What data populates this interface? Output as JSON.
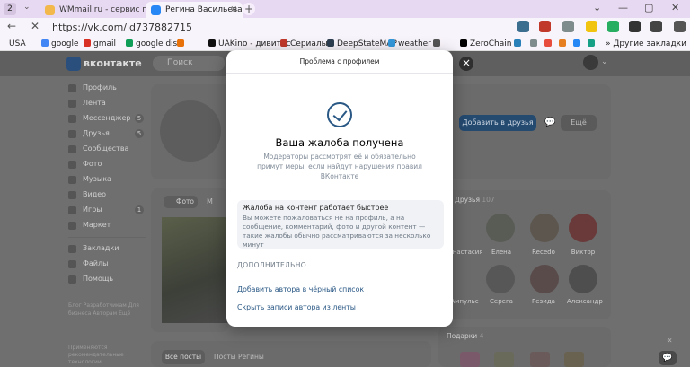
{
  "browser": {
    "tab_count": "2",
    "tabs": [
      {
        "title": "WMmail.ru - сервис почт"
      },
      {
        "title": "Регина Васильева"
      }
    ],
    "url": "https://vk.com/id737882715",
    "bookmarks": [
      "USA",
      "google",
      "gmail",
      "google disk",
      "",
      "UAKino - дивитис",
      "Сериалы",
      "DeepStateMAP",
      "weather",
      "",
      "ZeroChain",
      "",
      "",
      "",
      "",
      "",
      "",
      "Другие закладки"
    ]
  },
  "vk": {
    "brand": "вконтакте",
    "search_placeholder": "Поиск",
    "menu": [
      {
        "label": "Профиль",
        "badge": ""
      },
      {
        "label": "Лента",
        "badge": ""
      },
      {
        "label": "Мессенджер",
        "badge": "5"
      },
      {
        "label": "Друзья",
        "badge": "5"
      },
      {
        "label": "Сообщества",
        "badge": ""
      },
      {
        "label": "Фото",
        "badge": ""
      },
      {
        "label": "Музыка",
        "badge": ""
      },
      {
        "label": "Видео",
        "badge": ""
      },
      {
        "label": "Игры",
        "badge": "1"
      },
      {
        "label": "Маркет",
        "badge": ""
      },
      {
        "label": "Закладки",
        "badge": ""
      },
      {
        "label": "Файлы",
        "badge": ""
      },
      {
        "label": "Помощь",
        "badge": ""
      }
    ],
    "footer_links": [
      "Блог",
      "Разработчикам",
      "Для бизнеса",
      "Авторам",
      "Ещё"
    ],
    "footer_note": "Применяются рекомендательные технологии",
    "add_friend": "Добавить в друзья",
    "more_btn": "Ещё",
    "photos_tab": "Фото",
    "photos_tab2": "М",
    "friends_header": "Друзья",
    "friends_count": "107",
    "friends_row1": [
      "Анастасия",
      "Елена",
      "Recedo",
      "Виктор"
    ],
    "friends_row2": [
      "Ампульс",
      "Серега",
      "Резида",
      "Александр"
    ],
    "gifts_header": "Подарки",
    "gifts_count": "4",
    "posts_tab_all": "Все посты",
    "posts_tab_own": "Посты Регины"
  },
  "modal": {
    "title": "Проблема с профилем",
    "heading": "Ваша жалоба получена",
    "description": "Модераторы рассмотрят её и обязательно примут меры, если найдут нарушения правил ВКонтакте",
    "info_title": "Жалоба на контент работает быстрее",
    "info_text": "Вы можете пожаловаться не на профиль, а на сообщение, комментарий, фото и другой контент — такие жалобы обычно рассматриваются за несколько минут",
    "more_label": "ДОПОЛНИТЕЛЬНО",
    "link_blacklist": "Добавить автора в чёрный список",
    "link_hide": "Скрыть записи автора из ленты"
  },
  "colors": {
    "accent": "#2a5885",
    "tab_bar": "#e8d9f2",
    "overlay": "#6f6f6f"
  }
}
